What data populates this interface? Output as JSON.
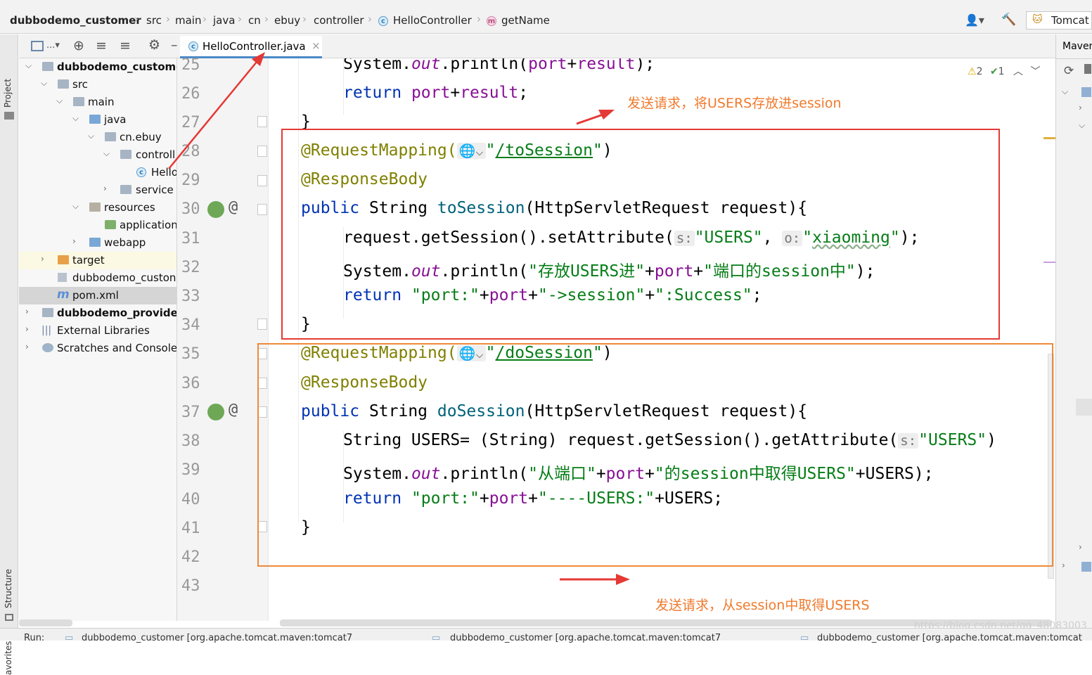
{
  "breadcrumb": {
    "project": "dubbodemo_customer",
    "items": [
      "src",
      "main",
      "java",
      "cn",
      "ebuy",
      "controller"
    ],
    "class_name": "HelloController",
    "method_name": "getName"
  },
  "toolbar": {
    "run_config": "Tomcat",
    "right_panel": "Maven"
  },
  "side_tabs": {
    "project": "Project",
    "structure": "Structure",
    "favorites": "avorites"
  },
  "editor_tab": {
    "label": "HelloController.java",
    "close": "×"
  },
  "inspections": {
    "warnings": "2",
    "ok": "1"
  },
  "tree": [
    {
      "label": "dubbodemo_customer",
      "bold": true
    },
    {
      "label": "src"
    },
    {
      "label": "main"
    },
    {
      "label": "java"
    },
    {
      "label": "cn.ebuy"
    },
    {
      "label": "controll"
    },
    {
      "label": "Hello"
    },
    {
      "label": "service"
    },
    {
      "label": "resources"
    },
    {
      "label": "application"
    },
    {
      "label": "webapp"
    },
    {
      "label": "target"
    },
    {
      "label": "dubbodemo_custon"
    },
    {
      "label": "pom.xml"
    },
    {
      "label": "dubbodemo_provider",
      "bold": true
    },
    {
      "label": "External Libraries"
    },
    {
      "label": "Scratches and Consoles"
    }
  ],
  "line_numbers": [
    "25",
    "26",
    "27",
    "28",
    "29",
    "30",
    "31",
    "32",
    "33",
    "34",
    "35",
    "36",
    "37",
    "38",
    "39",
    "40",
    "41",
    "42",
    "43"
  ],
  "code": {
    "l25": {
      "a": "System.",
      "b": "out",
      "c": ".println(",
      "d": "port",
      "e": "+",
      "f": "result",
      "g": ");"
    },
    "l26": {
      "a": "return ",
      "b": "port",
      "c": "+",
      "d": "result",
      "e": ";"
    },
    "l27": "}",
    "l28": {
      "a": "@RequestMapping(",
      "b": "\"",
      "c": "/toSession",
      "d": "\"",
      "e": ")"
    },
    "l29": "@ResponseBody",
    "l30": {
      "a": "public ",
      "b": "String ",
      "c": "toSession",
      "d": "(HttpServletRequest request){"
    },
    "l31": {
      "a": "request.getSession().setAttribute(",
      "h1": "s:",
      "b": "\"USERS\"",
      "c": ", ",
      "h2": "o:",
      "d": "\"",
      "e": "xiaoming",
      "f": "\"",
      "g": ");"
    },
    "l32": {
      "a": "System.",
      "b": "out",
      "c": ".println(",
      "d": "\"存放USERS进\"",
      "e": "+",
      "f": "port",
      "g": "+",
      "h": "\"端口的session中\"",
      "i": ");"
    },
    "l33": {
      "a": "return ",
      "b": "\"port:\"",
      "c": "+",
      "d": "port",
      "e": "+",
      "f": "\"->session\"",
      "g": "+",
      "h": "\":Success\"",
      "i": ";"
    },
    "l34": "}",
    "l35": {
      "a": "@RequestMapping(",
      "b": "\"",
      "c": "/doSession",
      "d": "\"",
      "e": ")"
    },
    "l36": "@ResponseBody",
    "l37": {
      "a": "public ",
      "b": "String ",
      "c": "doSession",
      "d": "(HttpServletRequest request){"
    },
    "l38": {
      "a": "String USERS= (String) request.getSession().getAttribute(",
      "h1": "s:",
      "b": "\"USERS\"",
      "c": ")"
    },
    "l39": {
      "a": "System.",
      "b": "out",
      "c": ".println(",
      "d": "\"从端口\"",
      "e": "+",
      "f": "port",
      "g": "+",
      "h": "\"的session中取得USERS\"",
      "i": "+USERS);"
    },
    "l40": {
      "a": "return ",
      "b": "\"port:\"",
      "c": "+",
      "d": "port",
      "e": "+",
      "f": "\"----USERS:\"",
      "g": "+USERS;"
    },
    "l41": "}"
  },
  "annotations": {
    "top": "发送请求，将USERS存放进session",
    "bottom": "发送请求，从session中取得USERS"
  },
  "bottom_bar": {
    "run_label": "Run:",
    "tab1": "dubbodemo_customer [org.apache.tomcat.maven:tomcat7",
    "tab2": "dubbodemo_customer [org.apache.tomcat.maven:tomcat7",
    "tab3": "dubbodemo_customer [org.apache.tomcat.maven:tomcat"
  },
  "watermark": "https://blog.csdn.net/qq_48083003",
  "colors": {
    "keyword": "#0033b3",
    "annotation": "#808000",
    "string": "#067d17",
    "method": "#00627a",
    "field": "#871094",
    "red_box": "#e53935",
    "orange_box": "#ef8a3a",
    "note_text": "#f07a2c"
  }
}
